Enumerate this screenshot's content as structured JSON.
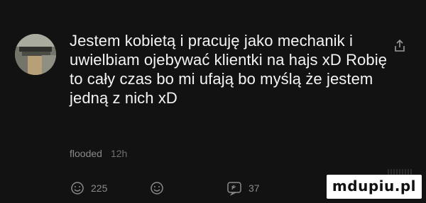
{
  "comment": {
    "text": "Jestem kobietą i pracuję jako mechanik i uwielbiam ojebywać klientki na hajs xD Robię to cały czas bo mi ufają bo myślą że jestem jedną z nich xD",
    "author": "flooded",
    "time": "12h"
  },
  "actions": {
    "like_count": "225",
    "reply_count": "37"
  },
  "icons": {
    "avatar": "avatar-image",
    "share": "share-icon",
    "like": "smiley-icon",
    "react": "smiley-icon",
    "reply": "reply-icon"
  },
  "watermark": {
    "text": "mdupiu.pl"
  },
  "colors": {
    "background": "#121212",
    "text": "#f4f4f4",
    "muted": "#8a8a8a"
  }
}
